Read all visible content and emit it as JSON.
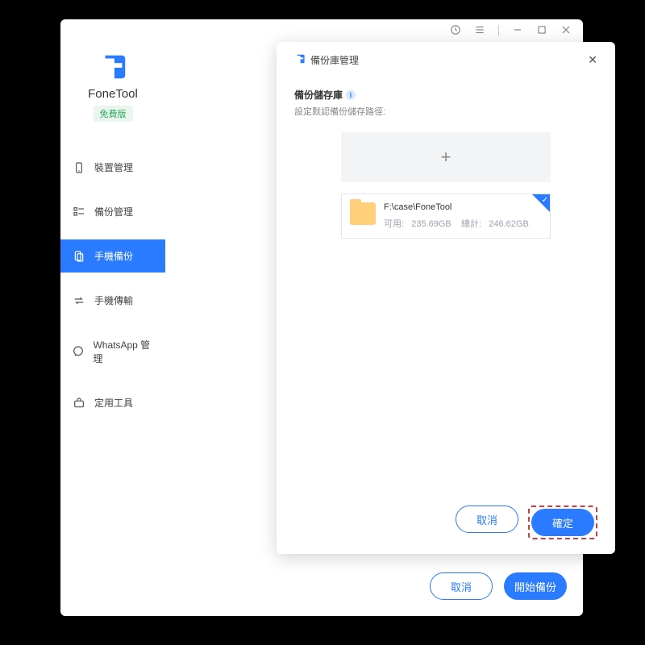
{
  "brand": {
    "name": "FoneTool",
    "badge": "免費版"
  },
  "sidebar": {
    "items": [
      {
        "label": "裝置管理",
        "icon": "device"
      },
      {
        "label": "備份管理",
        "icon": "backup-list"
      },
      {
        "label": "手機備份",
        "icon": "phone-backup",
        "active": true
      },
      {
        "label": "手機傳輸",
        "icon": "transfer"
      },
      {
        "label": "WhatsApp 管理",
        "icon": "whatsapp"
      },
      {
        "label": "定用工具",
        "icon": "toolkit"
      }
    ]
  },
  "bottom": {
    "cancel": "取消",
    "start": "開始備份"
  },
  "modal": {
    "title": "備份庫管理",
    "section_title": "備份儲存庫",
    "section_sub": "設定默認備份儲存路徑:",
    "path": {
      "location": "F:\\case\\FoneTool",
      "avail_label": "可用:",
      "avail_value": "235.69GB",
      "total_label": "總計:",
      "total_value": "246.62GB"
    },
    "add_plus": "+",
    "cancel": "取消",
    "confirm": "確定"
  }
}
